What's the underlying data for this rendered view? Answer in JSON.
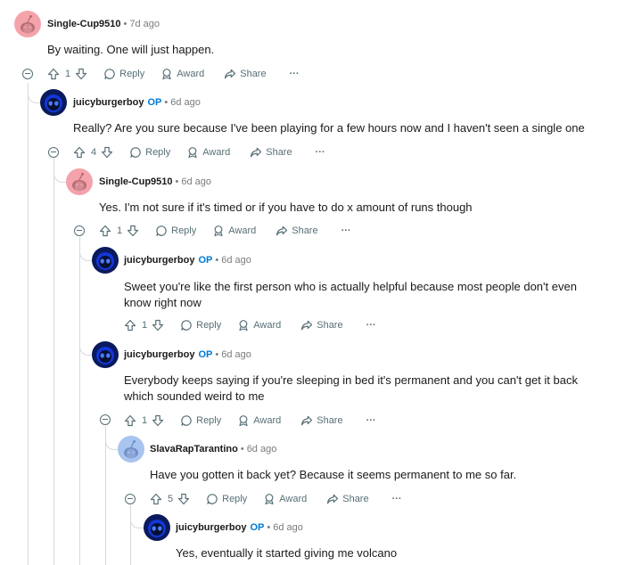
{
  "labels": {
    "reply": "Reply",
    "award": "Award",
    "share": "Share",
    "more": "···",
    "op_badge": "OP"
  },
  "comments": [
    {
      "author": "Single-Cup9510",
      "age": "7d ago",
      "text": "By waiting. One will just happen.",
      "score": "1"
    },
    {
      "author": "juicyburgerboy",
      "age": "6d ago",
      "text": "Really? Are you sure because I've been playing for a few hours now and I haven't seen a single one",
      "score": "4"
    },
    {
      "author": "Single-Cup9510",
      "age": "6d ago",
      "text": "Yes. I'm not sure if it's timed or if you have to do x amount of runs though",
      "score": "1"
    },
    {
      "author": "juicyburgerboy",
      "age": "6d ago",
      "text": "Sweet you're like the first person who is actually helpful because most people don't even know right now",
      "score": "1"
    },
    {
      "author": "juicyburgerboy",
      "age": "6d ago",
      "text": "Everybody keeps saying if you're sleeping in bed it's permanent and you can't get it back which sounded weird to me",
      "score": "1"
    },
    {
      "author": "SlavaRapTarantino",
      "age": "6d ago",
      "text": "Have you gotten it back yet? Because it seems permanent to me so far.",
      "score": "5"
    },
    {
      "author": "juicyburgerboy",
      "age": "6d ago",
      "text": "Yes, eventually it started giving me volcano"
    }
  ]
}
